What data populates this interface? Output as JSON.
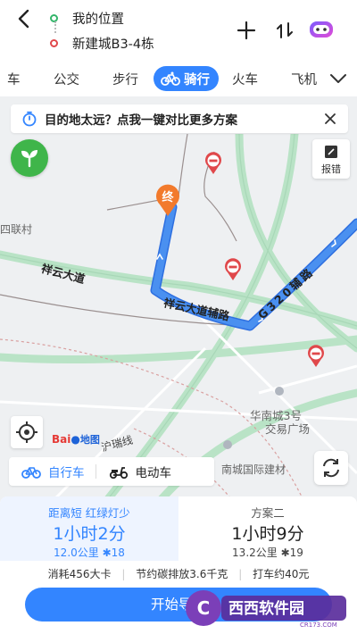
{
  "header": {
    "origin": "我的位置",
    "destination": "新建城B3-4栋"
  },
  "tabs": [
    {
      "label": "车"
    },
    {
      "label": "公交"
    },
    {
      "label": "步行"
    },
    {
      "label": "骑行",
      "active": true
    },
    {
      "label": "火车"
    },
    {
      "label": "飞机"
    }
  ],
  "banner": {
    "text": "目的地太远？点我一键对比更多方案"
  },
  "map": {
    "report_label": "报错",
    "end_marker": "终",
    "logo_text": "Bai",
    "logo_map": "地图",
    "places": {
      "village": "四联村",
      "mall_line1": "华南城3号",
      "mall_line2": "交易广场",
      "building_material": "南城国际建材",
      "line_road": "沪瑞线"
    },
    "roads": {
      "xiangyun": "祥云大道",
      "xiangyun_aux": "祥云大道辅路",
      "g320_aux": "G320辅路"
    }
  },
  "vehicle_tabs": [
    {
      "label": "自行车",
      "active": true
    },
    {
      "label": "电动车"
    }
  ],
  "plans": [
    {
      "tag": "距离短 红绿灯少",
      "time": "1小时2分",
      "distance": "12.0公里",
      "lights": "18"
    },
    {
      "tag": "方案二",
      "time": "1小时9分",
      "distance": "13.2公里",
      "lights": "19"
    }
  ],
  "info": {
    "calories": "消耗456大卡",
    "carbon": "节约碳排放3.6千克",
    "taxi": "打车约40元"
  },
  "start_button": "开始导航",
  "watermark": {
    "brand": "西西软件园",
    "site": "CR173.COM"
  },
  "colors": {
    "accent": "#3385ff",
    "route": "#4a90f0",
    "green": "#3fb54a",
    "red": "#e0484b"
  }
}
